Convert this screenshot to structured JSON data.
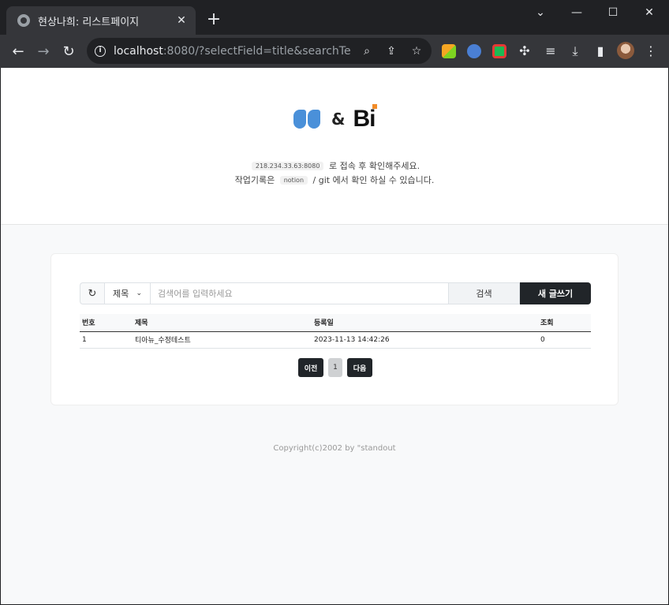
{
  "browser": {
    "tab_title": "현상나희: 리스트페이지",
    "close_glyph": "✕",
    "newtab_glyph": "+",
    "url_host": "localhost",
    "url_rest": ":8080/?selectField=title&searchText=...",
    "window_controls": {
      "minimize": "⌄",
      "min2": "—",
      "max": "☐",
      "close": "✕"
    }
  },
  "hero": {
    "logo_amp": "&",
    "logo_bi": "Bi",
    "line1_chip": "218.234.33.63:8080",
    "line1_text": "로 접속 후 확인해주세요.",
    "line2_pre": "작업기록은",
    "line2_chip": "notion",
    "line2_post": "/ git 에서 확인 하실 수 있습니다."
  },
  "search": {
    "reset_glyph": "↻",
    "select_value": "제목",
    "placeholder": "검색어를 입력하세요",
    "search_label": "검색",
    "write_label": "새 글쓰기"
  },
  "table": {
    "headers": [
      "번호",
      "제목",
      "등록일",
      "조회"
    ],
    "rows": [
      [
        "1",
        "티아뉴_수정테스트",
        "2023-11-13 14:42:26",
        "0"
      ]
    ]
  },
  "pager": {
    "prev": "이전",
    "current": "1",
    "next": "다음"
  },
  "footer": {
    "text": "Copyright(c)2002 by \"standout"
  }
}
